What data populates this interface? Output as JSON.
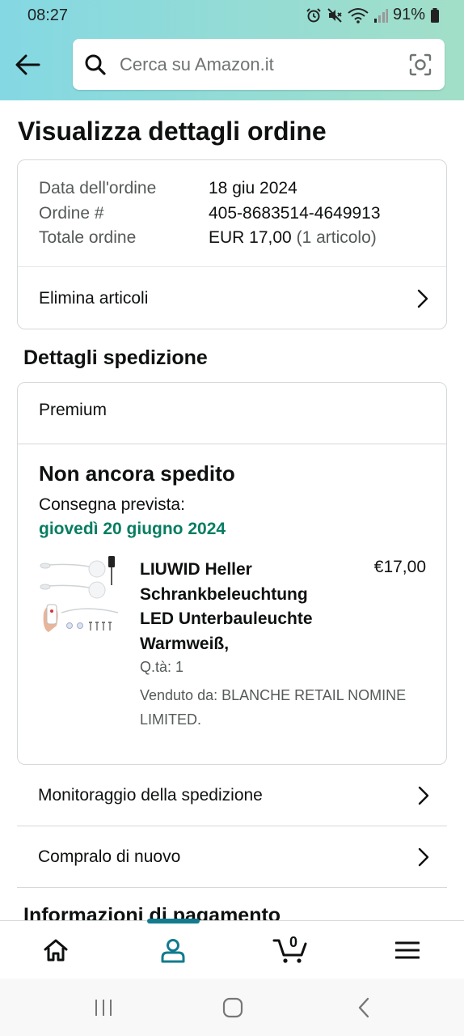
{
  "status_bar": {
    "time": "08:27",
    "battery": "91%"
  },
  "search": {
    "placeholder": "Cerca su Amazon.it"
  },
  "page_title": "Visualizza dettagli ordine",
  "order_summary": {
    "date_label": "Data dell'ordine",
    "date_value": "18 giu 2024",
    "number_label": "Ordine #",
    "number_value": "405-8683514-4649913",
    "total_label": "Totale ordine",
    "total_value": "EUR 17,00",
    "total_items": "(1 articolo)",
    "delete_items": "Elimina articoli"
  },
  "shipping": {
    "section_title": "Dettagli spedizione",
    "type": "Premium",
    "status": "Non ancora spedito",
    "eta_label": "Consegna prevista:",
    "eta_date": "giovedì 20 giugno 2024",
    "product": {
      "title": "LIUWID Heller Schrankbeleuchtung LED Unterbauleuchte Warmweiß,",
      "price": "€17,00",
      "qty": "Q.tà: 1",
      "seller": "Venduto da: BLANCHE RETAIL NOMINE LIMITED."
    }
  },
  "links": {
    "tracking": "Monitoraggio della spedizione",
    "buy_again": "Compralo di nuovo"
  },
  "payment_title": "Informazioni di pagamento",
  "bottom_nav": {
    "cart_count": "0",
    "active": "account"
  },
  "colors": {
    "accent": "#127b8e",
    "eta_green": "#067d62",
    "header_from": "#84d8e3",
    "header_to": "#a2dfc8"
  }
}
